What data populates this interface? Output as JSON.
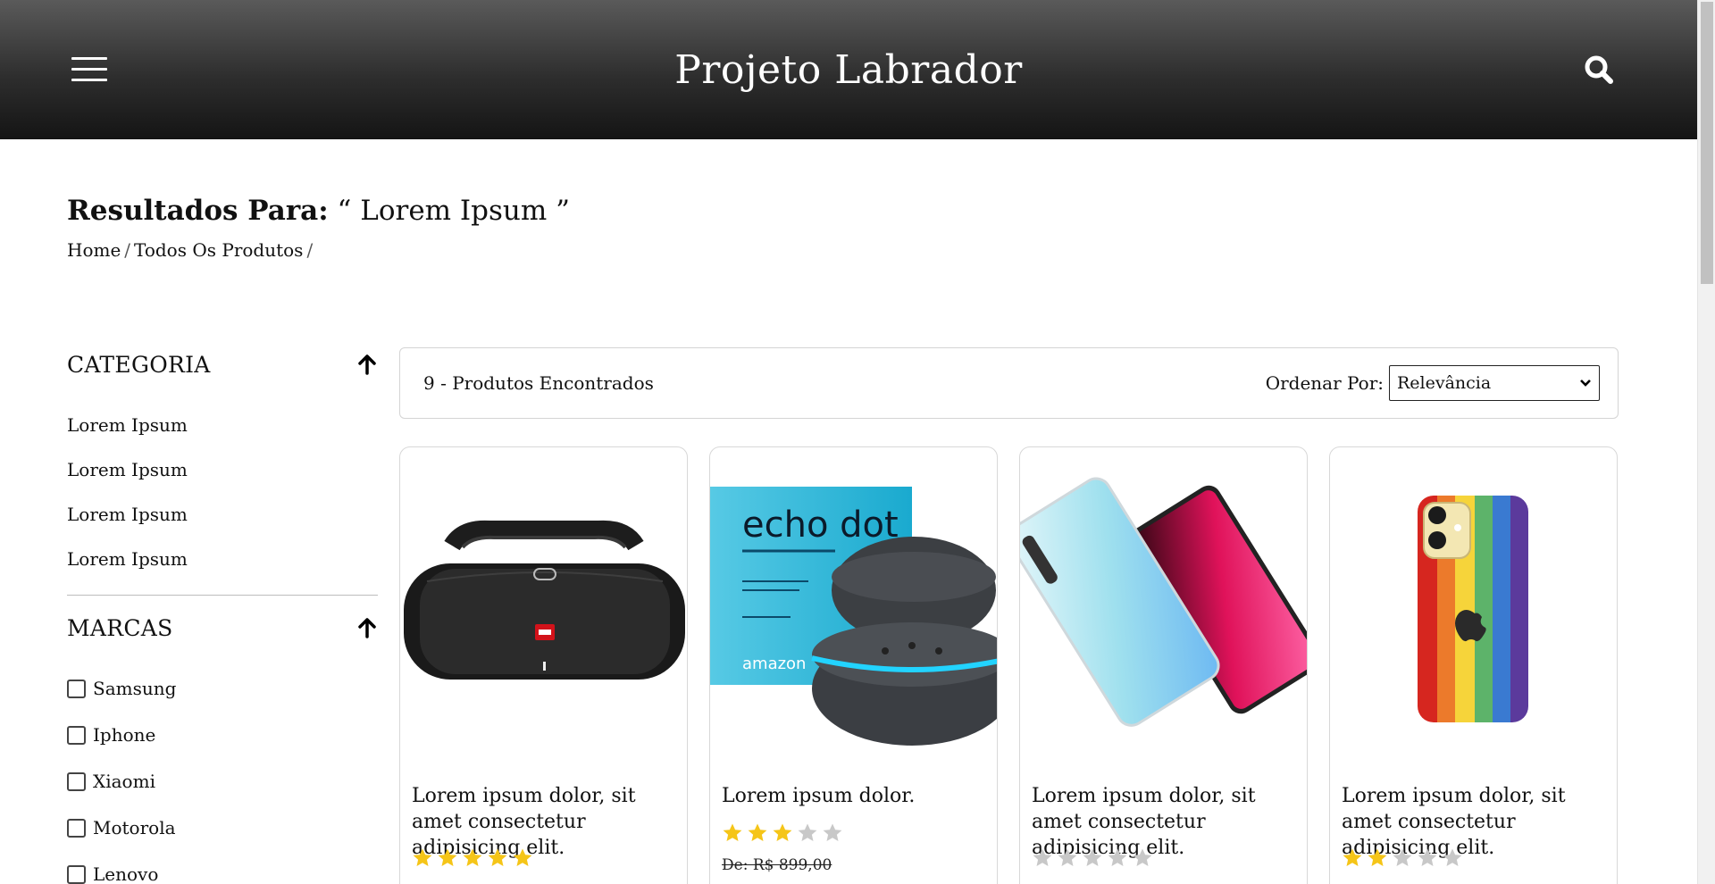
{
  "header": {
    "title": "Projeto Labrador"
  },
  "page": {
    "results_label": "Resultados Para:",
    "query": "“ Lorem Ipsum ”",
    "breadcrumb": [
      "Home",
      "Todos Os Produtos"
    ]
  },
  "sidebar": {
    "categories_title": "CATEGORIA",
    "categories": [
      "Lorem Ipsum",
      "Lorem Ipsum",
      "Lorem Ipsum",
      "Lorem Ipsum"
    ],
    "brands_title": "MARCAS",
    "brands": [
      "Samsung",
      "Iphone",
      "Xiaomi",
      "Motorola",
      "Lenovo"
    ]
  },
  "results": {
    "count_text": "9 - Produtos Encontrados",
    "sort_label": "Ordenar Por:",
    "sort_selected": "Relevância"
  },
  "products": [
    {
      "name": "Lorem ipsum dolor, sit amet consectetur adipisicing elit.",
      "rating": 5,
      "image": "jbl-speaker"
    },
    {
      "name": "Lorem ipsum dolor.",
      "rating": 3,
      "old_price": "De: R$ 899,00",
      "image": "echo-dot"
    },
    {
      "name": "Lorem ipsum dolor, sit amet consectetur adipisicing elit.",
      "rating": 0,
      "image": "smartphone"
    },
    {
      "name": "Lorem ipsum dolor, sit amet consectetur adipisicing elit.",
      "rating": 2,
      "image": "iphone-rainbow-case"
    }
  ],
  "product_images": {
    "echo_dot_box_title": "echo dot",
    "echo_dot_brand": "amazon"
  },
  "colors": {
    "star_filled": "#f5c518",
    "star_empty": "#c8c8c8"
  }
}
